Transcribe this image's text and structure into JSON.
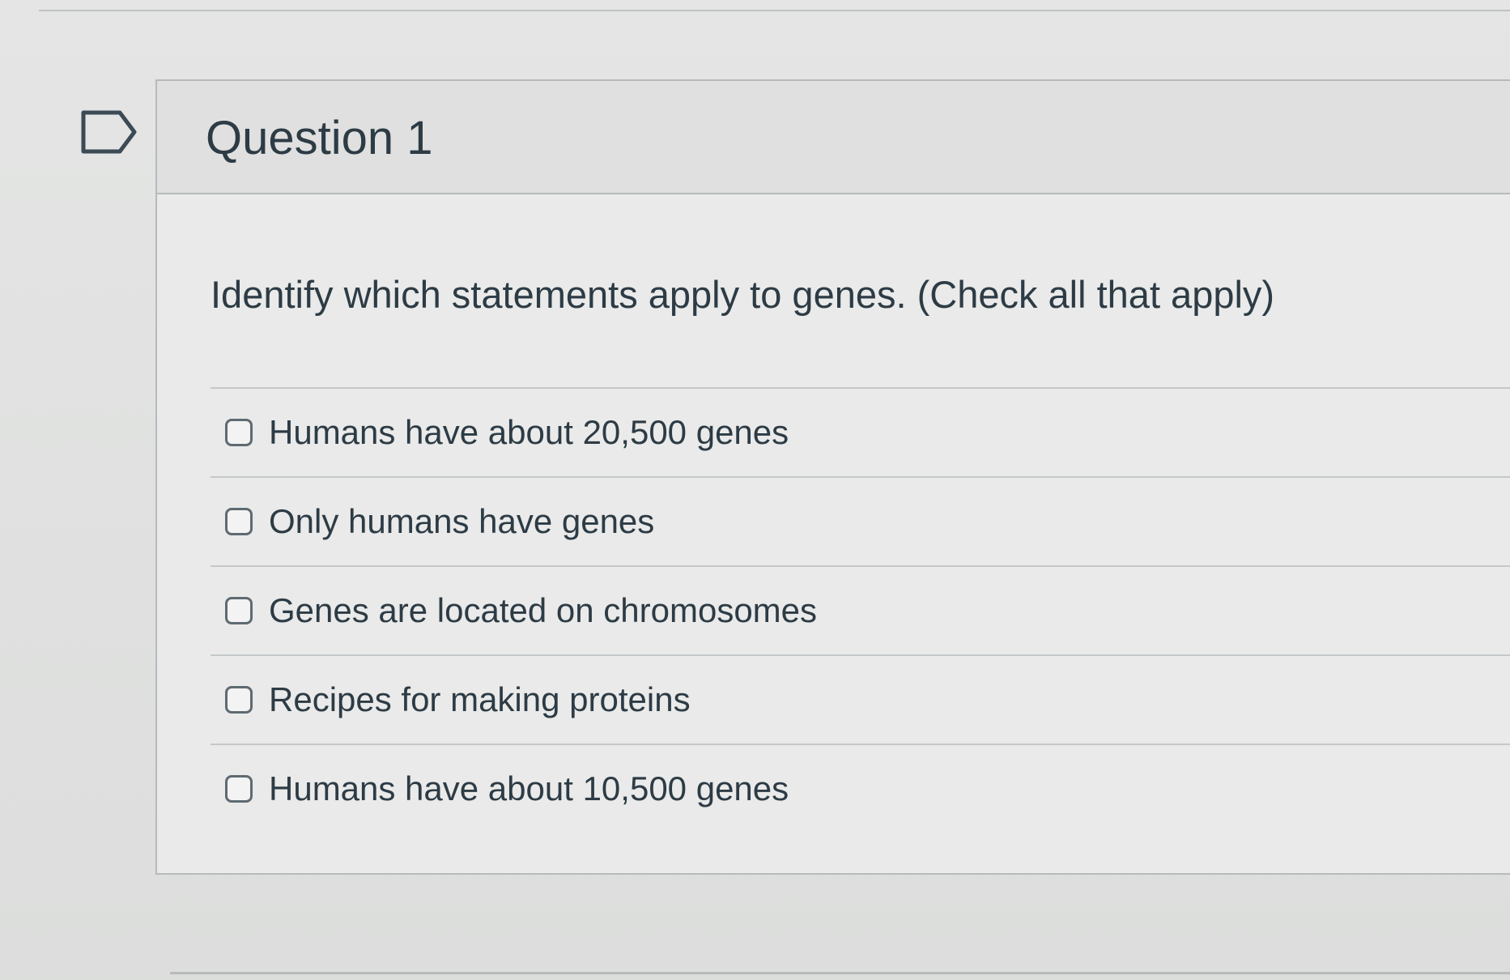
{
  "question": {
    "title": "Question 1",
    "prompt": "Identify which statements apply to genes.  (Check all that apply)",
    "answers": [
      {
        "label": "Humans have about 20,500 genes",
        "checked": false
      },
      {
        "label": "Only humans have genes",
        "checked": false
      },
      {
        "label": "Genes are located on chromosomes",
        "checked": false
      },
      {
        "label": "Recipes for making proteins",
        "checked": false
      },
      {
        "label": "Humans have about 10,500 genes",
        "checked": false
      }
    ]
  },
  "icons": {
    "flag": "flag-outline-icon"
  },
  "colors": {
    "text": "#2d3b45",
    "border": "#b6babc",
    "header_bg": "#dfe0df",
    "card_bg": "#e9eae9"
  }
}
